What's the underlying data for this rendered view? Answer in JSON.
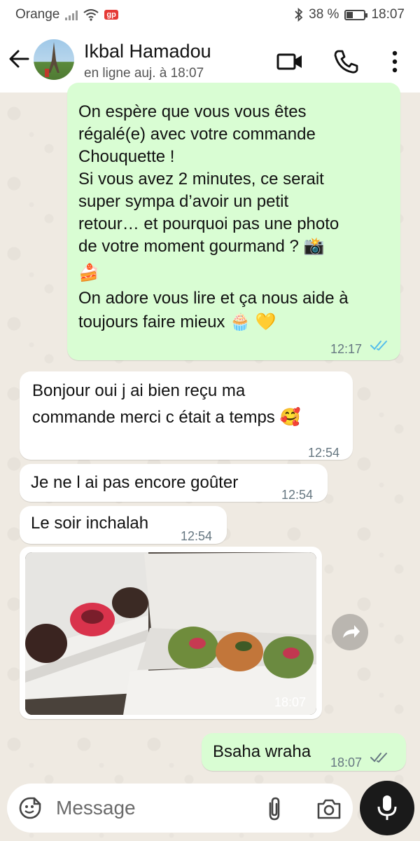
{
  "status_bar": {
    "carrier": "Orange",
    "battery_text": "38 %",
    "battery_level": 0.38,
    "time": "18:07"
  },
  "header": {
    "contact_name": "Ikbal Hamadou",
    "presence": "en ligne auj. à 18:07"
  },
  "messages": {
    "m1": {
      "line1": "On espère que vous vous êtes",
      "line2": "régalé(e) avec votre commande",
      "line3": "Chouquette !",
      "line4": "Si vous avez 2 minutes, ce serait",
      "line5": "super sympa d’avoir un petit",
      "line6": "retour… et pourquoi pas une photo",
      "line7": "de votre moment gourmand ? 📸",
      "line8": "🍰",
      "line9": "On adore vous lire et ça nous aide à",
      "line10": "toujours faire mieux 🧁 💛",
      "time": "12:17"
    },
    "m2": {
      "line1": "Bonjour oui j ai bien reçu ma",
      "line2": "commande merci c était a temps 🥰",
      "time": "12:54"
    },
    "m3": {
      "text": "Je ne l ai pas encore goûter",
      "time": "12:54"
    },
    "m4": {
      "text": "Le soir inchalah",
      "time": "12:54"
    },
    "m5": {
      "time": "18:07"
    },
    "m6": {
      "text": "Bsaha wraha",
      "time": "18:07"
    }
  },
  "composer": {
    "placeholder": "Message"
  }
}
